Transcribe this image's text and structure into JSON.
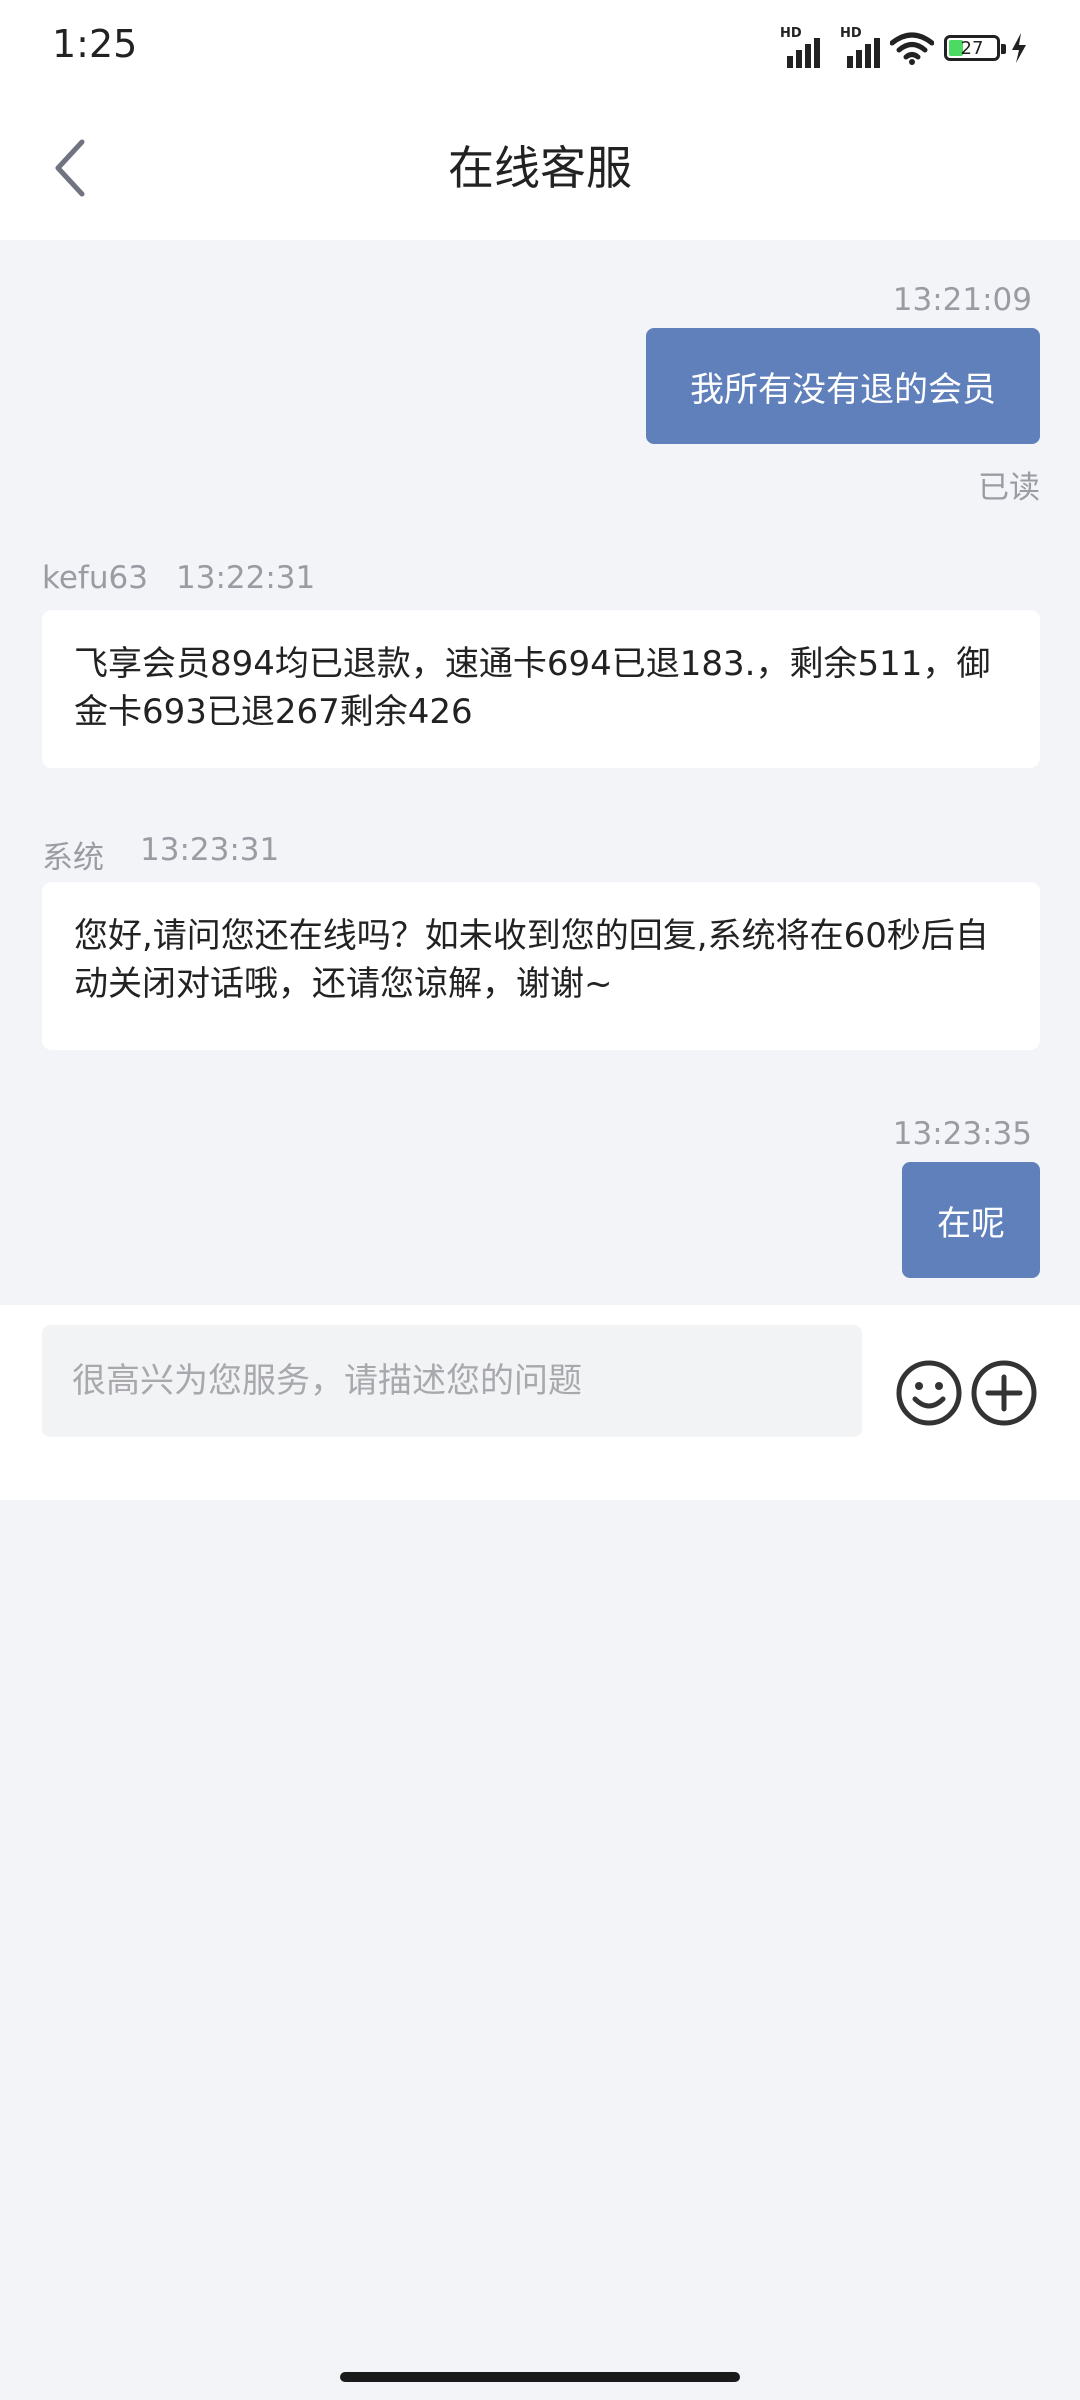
{
  "status_bar": {
    "time": "1:25",
    "signal_1_label": "HD",
    "signal_2_label": "HD",
    "battery_level": "27"
  },
  "header": {
    "title": "在线客服"
  },
  "messages": [
    {
      "sender": "me",
      "time": "13:21:09",
      "text": "我所有没有退的会员",
      "status": "已读"
    },
    {
      "sender": "kefu63",
      "time": "13:22:31",
      "text": "飞享会员894均已退款，速通卡694已退183.，剩余511，御金卡693已退267剩余426"
    },
    {
      "sender": "系统",
      "time": "13:23:31",
      "text": "您好,请问您还在线吗？如未收到您的回复,系统将在60秒后自动关闭对话哦，还请您谅解，谢谢~"
    },
    {
      "sender": "me",
      "time": "13:23:35",
      "text": "在呢"
    }
  ],
  "composer": {
    "placeholder": "很高兴为您服务，请描述您的问题"
  },
  "colors": {
    "outgoing_bubble": "#6080bb",
    "background": "#f3f4f8"
  }
}
